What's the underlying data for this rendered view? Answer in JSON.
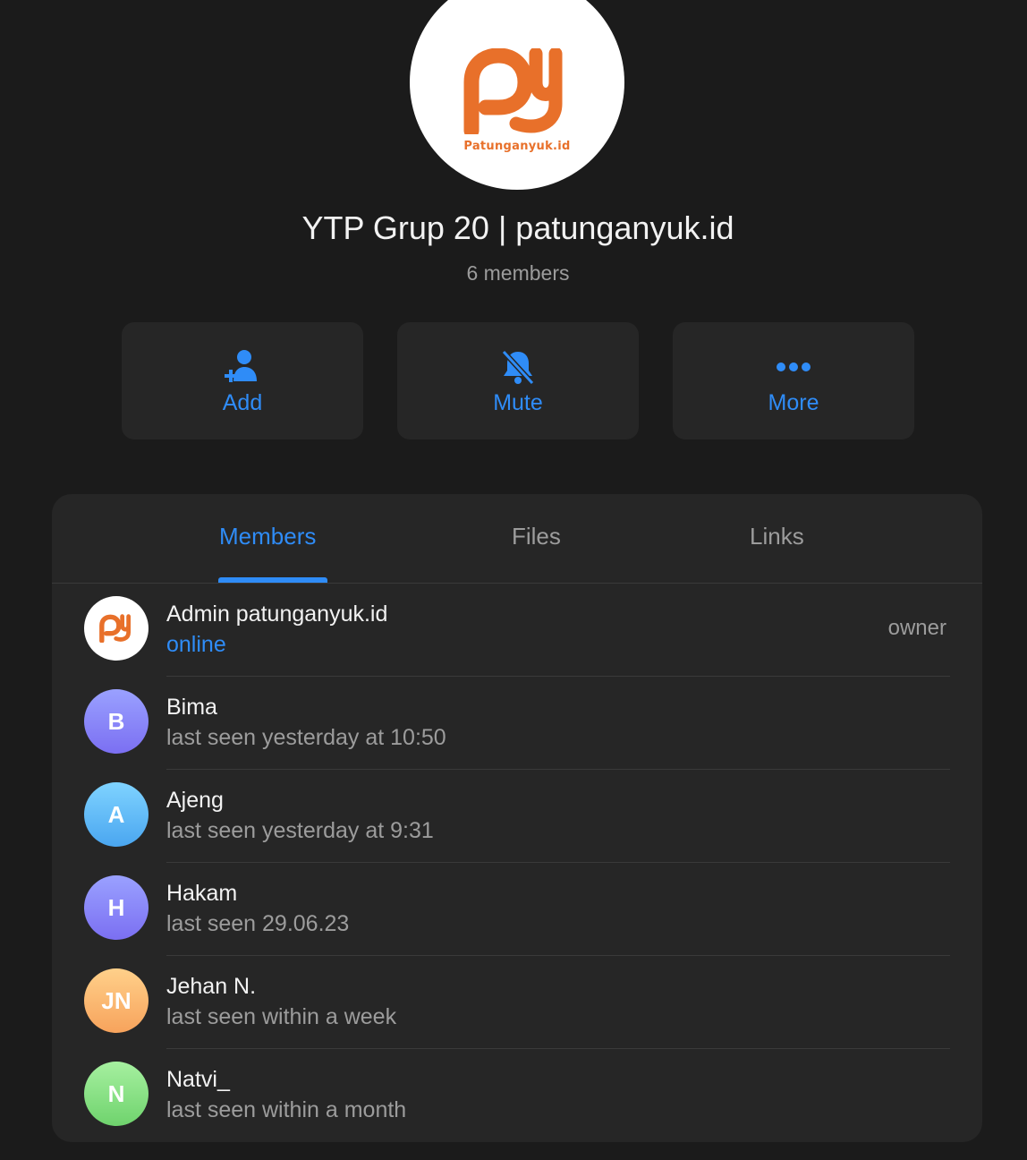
{
  "group": {
    "title": "YTP Grup 20 | patunganyuk.id",
    "member_count": "6 members",
    "logo_text": "Patunganyuk.id"
  },
  "actions": [
    {
      "label": "Add",
      "icon": "add-user-icon"
    },
    {
      "label": "Mute",
      "icon": "bell-slash-icon"
    },
    {
      "label": "More",
      "icon": "ellipsis-icon"
    }
  ],
  "tabs": [
    {
      "label": "Members",
      "active": true
    },
    {
      "label": "Files",
      "active": false
    },
    {
      "label": "Links",
      "active": false
    }
  ],
  "members": [
    {
      "name": "Admin patunganyuk.id",
      "status": "online",
      "role": "owner",
      "avatar": "logo"
    },
    {
      "name": "Bima",
      "status": "last seen yesterday at 10:50",
      "initials": "B",
      "colors": [
        "#9aa1ff",
        "#7b6ff2"
      ]
    },
    {
      "name": "Ajeng",
      "status": "last seen yesterday at 9:31",
      "initials": "A",
      "colors": [
        "#7fd3ff",
        "#4aa6f0"
      ]
    },
    {
      "name": "Hakam",
      "status": "last seen 29.06.23",
      "initials": "H",
      "colors": [
        "#9aa1ff",
        "#7b6ff2"
      ]
    },
    {
      "name": "Jehan N.",
      "status": "last seen within a week",
      "initials": "JN",
      "colors": [
        "#ffd08a",
        "#f7a35c"
      ]
    },
    {
      "name": "Natvi_",
      "status": "last seen within a month",
      "initials": "N",
      "colors": [
        "#a6f0a0",
        "#6fd36d"
      ]
    }
  ],
  "colors": {
    "accent": "#2f8cf7",
    "background": "#1b1b1b",
    "panel": "#262626",
    "brand_orange": "#e8702a"
  }
}
